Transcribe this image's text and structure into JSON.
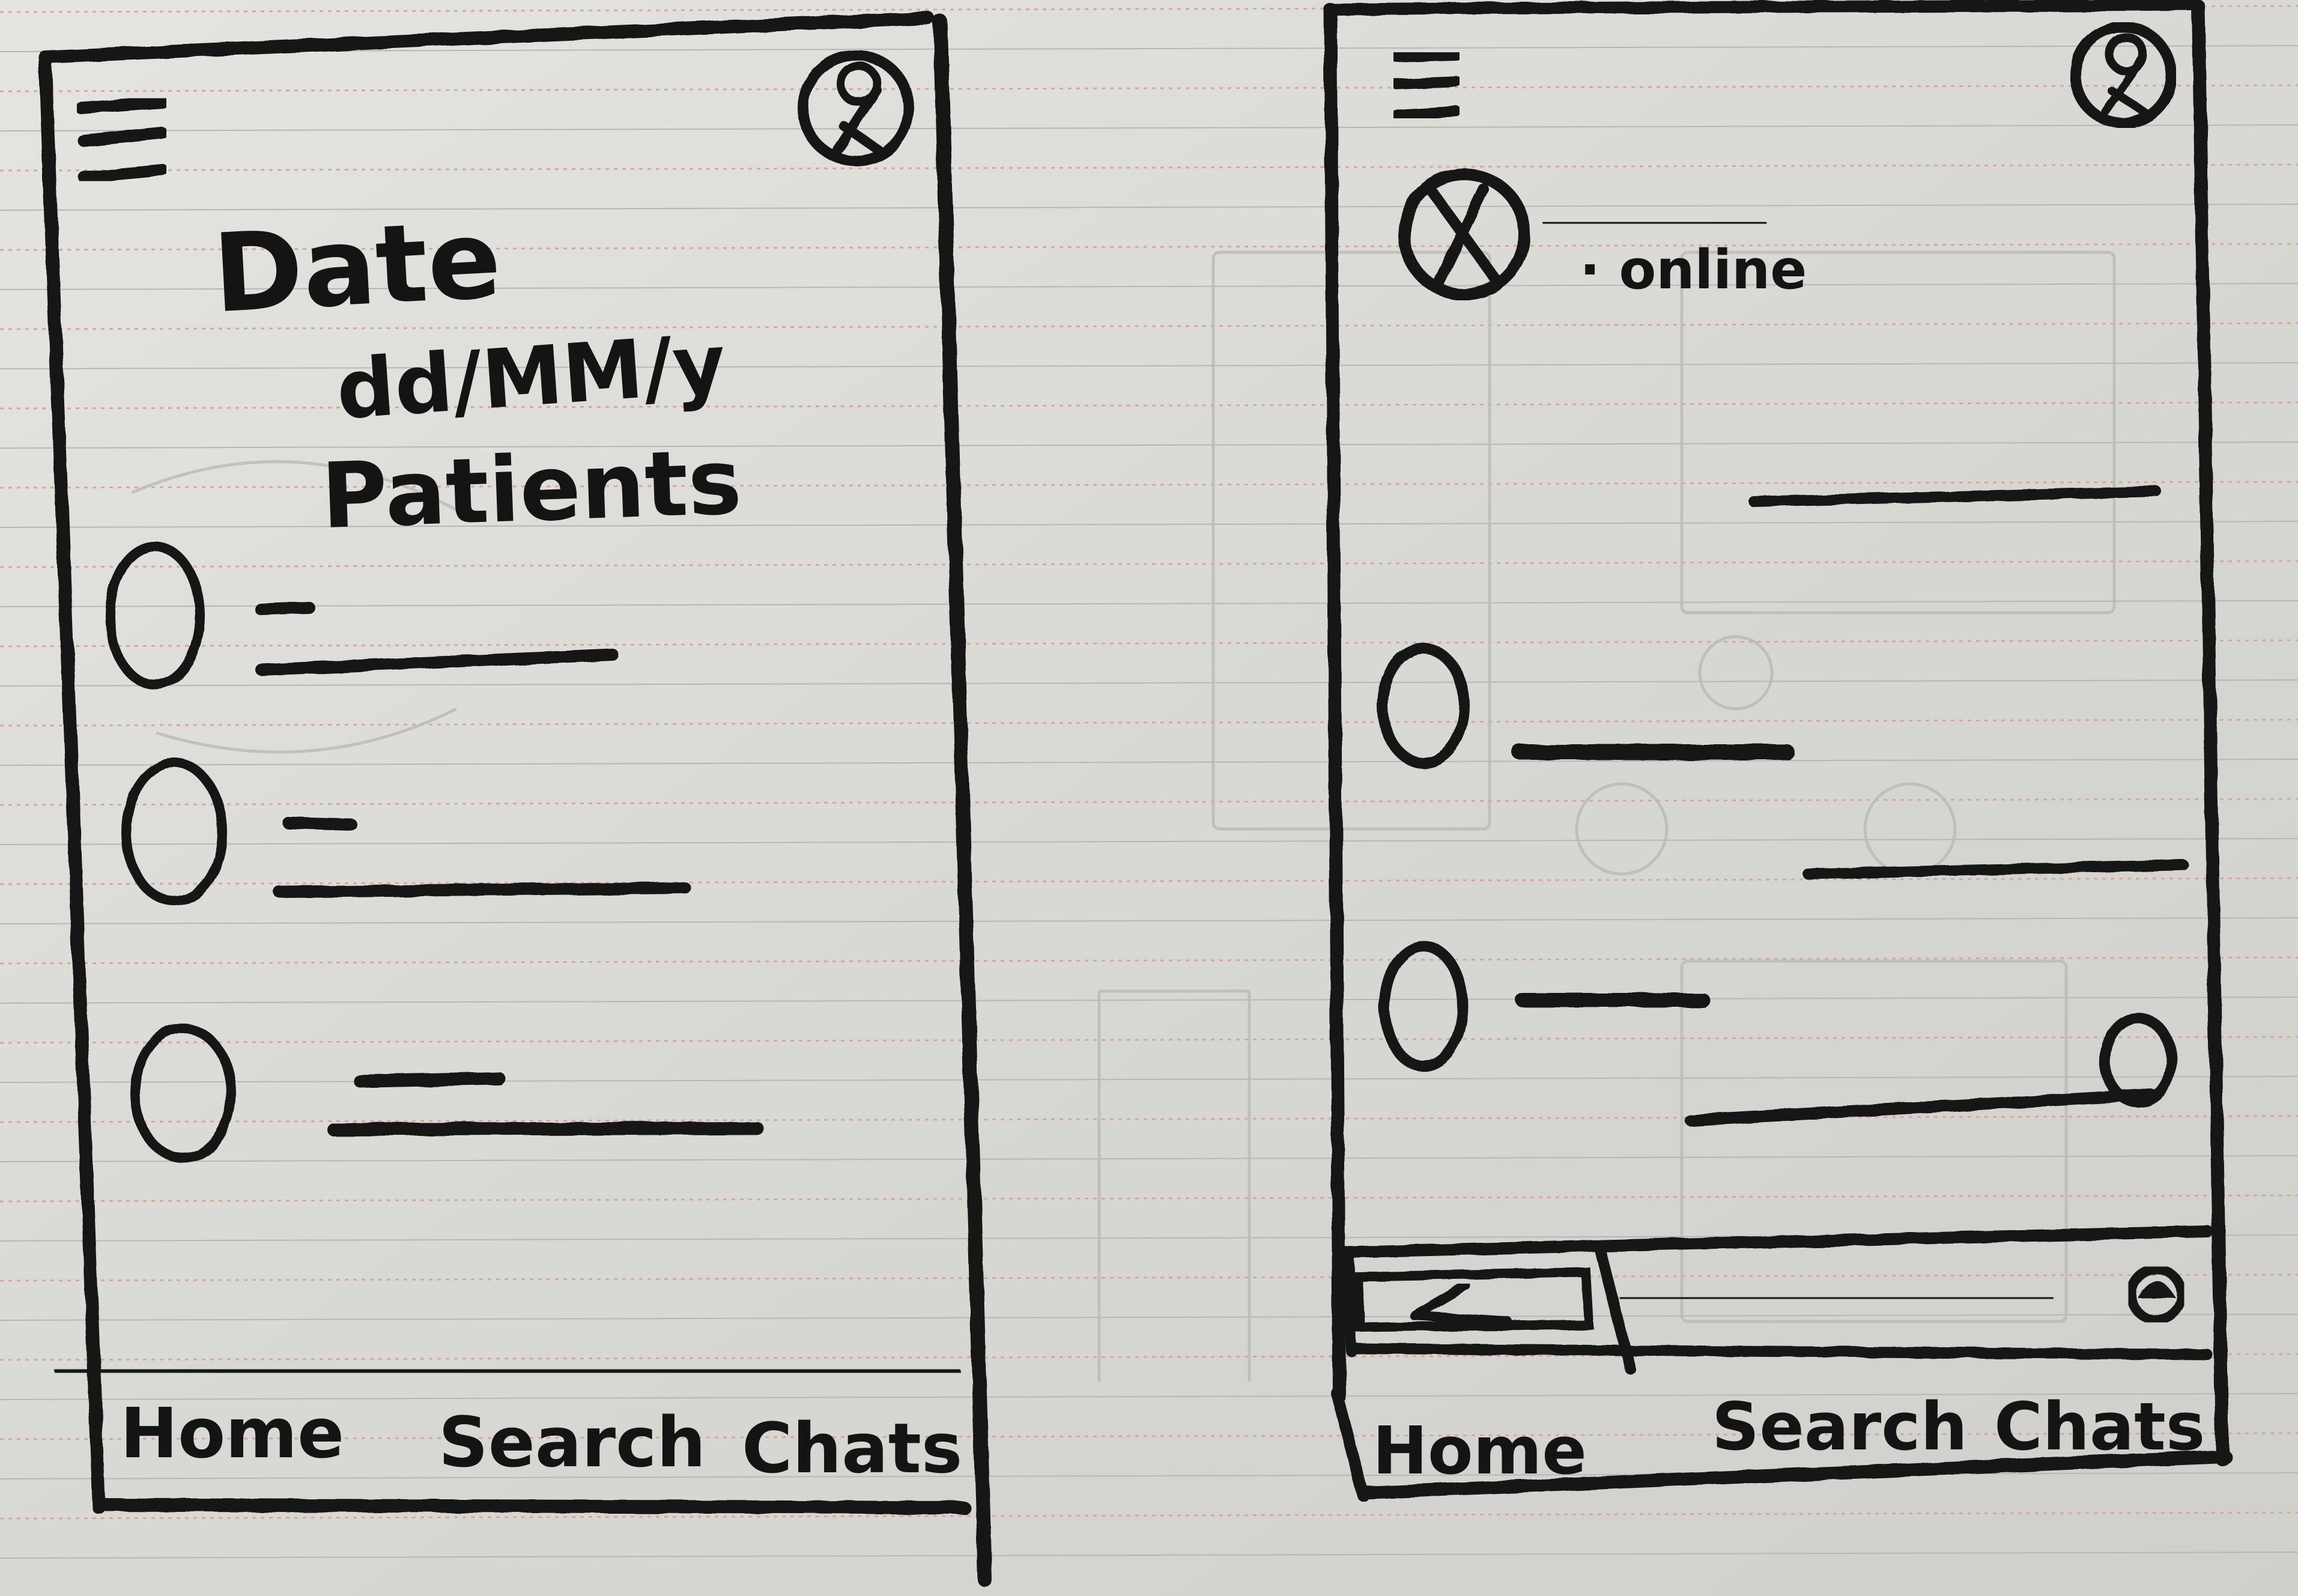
{
  "colors": {
    "paper": "#dcdcd8",
    "ink": "#141414",
    "rule_red": "#d9a89b",
    "rule_grey": "#b7b7b3",
    "faint_sketch": "#b9b9b5"
  },
  "left_screen": {
    "menu_icon": "hamburger-icon",
    "profile_icon": "profile-circle-icon",
    "title": "Date",
    "date_format": "dd/MM/y",
    "section_label": "Patients",
    "patients": [
      {
        "avatar": "circle-avatar-icon"
      },
      {
        "avatar": "circle-avatar-icon"
      },
      {
        "avatar": "circle-avatar-icon"
      }
    ],
    "nav": {
      "home": "Home",
      "search": "Search",
      "chats": "Chats"
    }
  },
  "right_screen": {
    "menu_icon": "hamburger-icon",
    "profile_icon": "profile-circle-icon",
    "contact": {
      "avatar": "crossed-circle-avatar-icon",
      "status": "· online"
    },
    "composer": {
      "send_icon": "share-icon",
      "emoji_icon": "emoji-icon"
    },
    "nav": {
      "home": "Home",
      "search": "Search",
      "chats": "Chats"
    }
  }
}
